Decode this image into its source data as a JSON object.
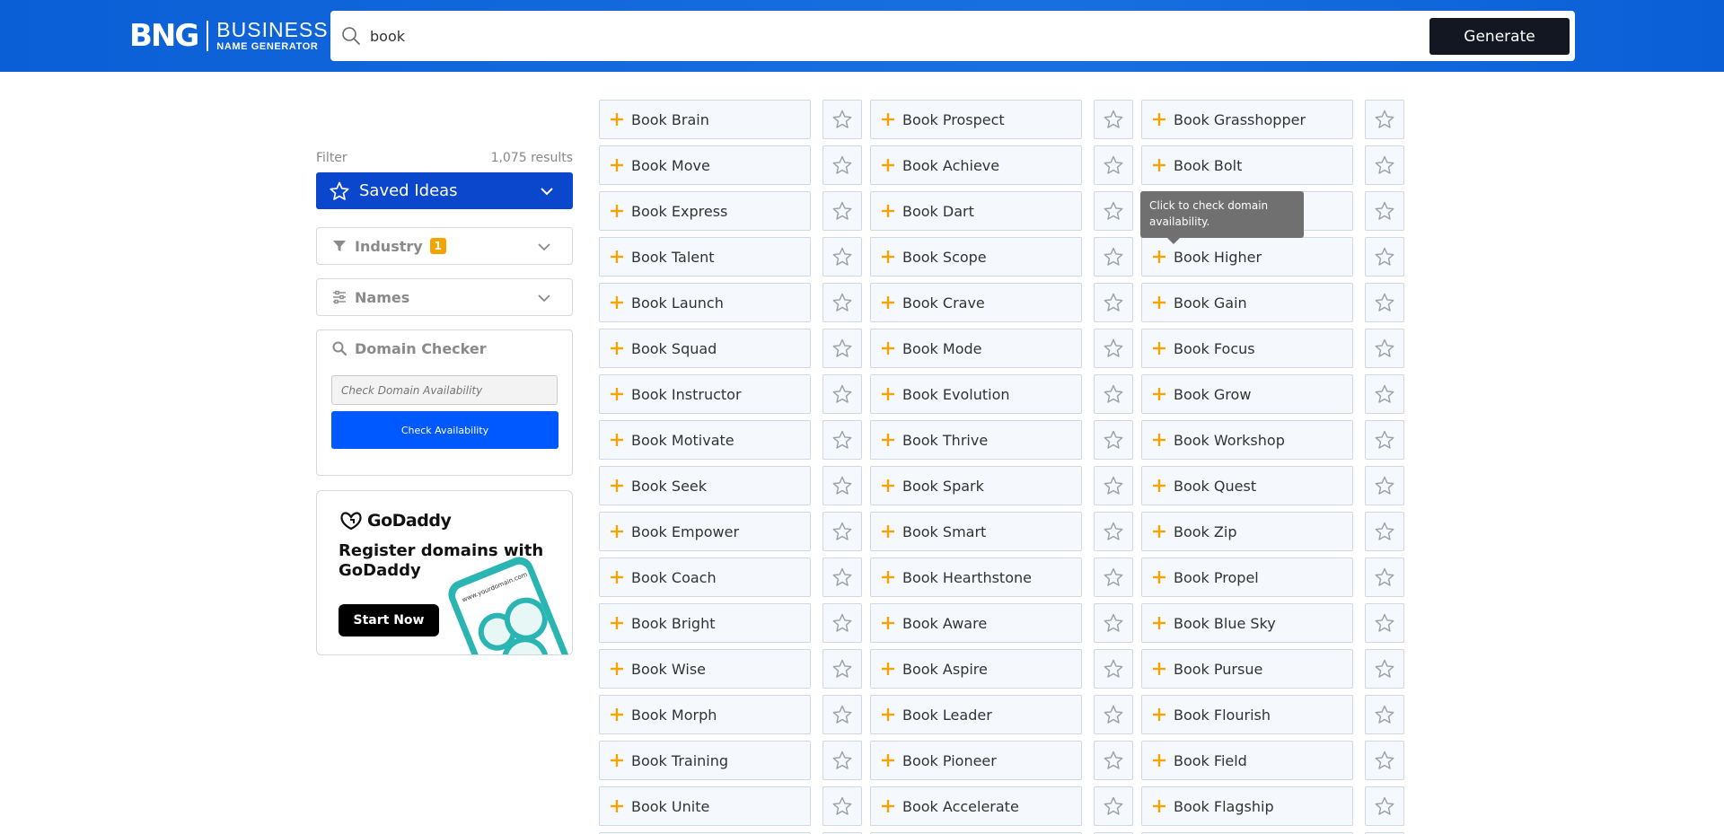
{
  "brand": {
    "mark": "BNG",
    "title": "BUSINESS",
    "subtitle": "NAME GENERATOR"
  },
  "search": {
    "value": "book",
    "button_label": "Generate"
  },
  "filter": {
    "label": "Filter",
    "results": "1,075 results"
  },
  "saved_ideas": {
    "label": "Saved Ideas"
  },
  "industry": {
    "label": "Industry",
    "badge": "1"
  },
  "names_panel": {
    "label": "Names"
  },
  "domain_checker": {
    "label": "Domain Checker",
    "placeholder": "Check Domain Availability",
    "button_label": "Check Availability"
  },
  "ad": {
    "brand": "GoDaddy",
    "title": "Register domains with GoDaddy",
    "button_label": "Start Now",
    "phone_url": "www.yourdomain.com"
  },
  "tooltip": {
    "text": "Click to check domain availability."
  },
  "colors": {
    "header": "#1a6fe0",
    "accent_blue": "#0b47cc",
    "button_blue": "#0058ff",
    "plus_orange": "#f5a300",
    "badge": "#f5a300"
  },
  "icons": {
    "search": "search-icon",
    "star": "star-outline-icon",
    "plus": "plus-icon",
    "chevron": "chevron-down-icon",
    "filter": "funnel-icon",
    "sliders": "sliders-icon"
  },
  "names": {
    "columns": [
      [
        "Book Brain",
        "Book Move",
        "Book Express",
        "Book Talent",
        "Book Launch",
        "Book Squad",
        "Book Instructor",
        "Book Motivate",
        "Book Seek",
        "Book Empower",
        "Book Coach",
        "Book Bright",
        "Book Wise",
        "Book Morph",
        "Book Training",
        "Book Unite"
      ],
      [
        "Book Prospect",
        "Book Achieve",
        "Book Dart",
        "Book Scope",
        "Book Crave",
        "Book Mode",
        "Book Evolution",
        "Book Thrive",
        "Book Spark",
        "Book Smart",
        "Book Hearthstone",
        "Book Aware",
        "Book Aspire",
        "Book Leader",
        "Book Pioneer",
        "Book Accelerate"
      ],
      [
        "Book Grasshopper",
        "Book Bolt",
        "",
        "Book Higher",
        "Book Gain",
        "Book Focus",
        "Book Grow",
        "Book Workshop",
        "Book Quest",
        "Book Zip",
        "Book Propel",
        "Book Blue Sky",
        "Book Pursue",
        "Book Flourish",
        "Book Field",
        "Book Flagship"
      ]
    ]
  }
}
